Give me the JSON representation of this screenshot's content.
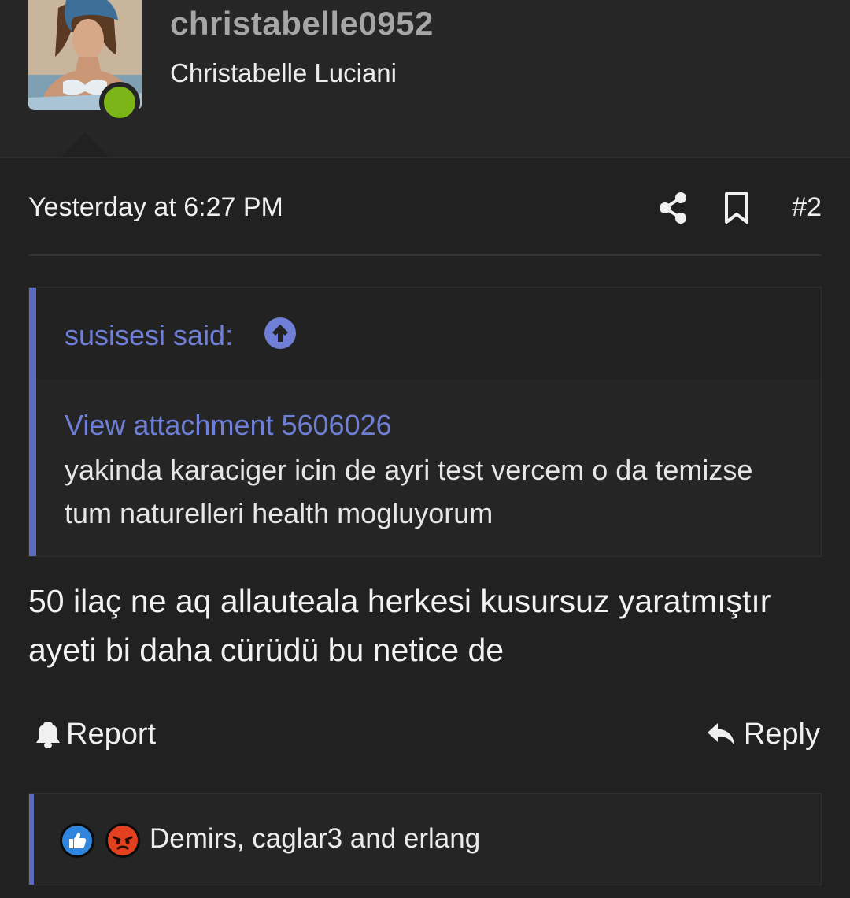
{
  "user": {
    "username": "christabelle0952",
    "display_name": "Christabelle Luciani",
    "status_color": "#7cb518"
  },
  "post": {
    "date": "Yesterday at 6:27 PM",
    "number": "#2",
    "share_icon": "share-icon",
    "bookmark_icon": "bookmark-icon"
  },
  "quote": {
    "author": "susisesi said:",
    "attachment_link": "View attachment 5606026",
    "text": "yakinda karaciger icin de ayri test vercem o da temizse tum naturelleri health mogluyorum",
    "accent_color": "#5c6bc0"
  },
  "message": {
    "text": "50 ilaç ne aq allauteala herkesi kusursuz yaratmıştır ayeti bi daha cürüdü bu netice de"
  },
  "actions": {
    "report_label": "Report",
    "reply_label": "Reply"
  },
  "reactions": {
    "text": "Demirs, caglar3 and erlang",
    "icons": [
      "like-icon",
      "angry-icon"
    ]
  }
}
